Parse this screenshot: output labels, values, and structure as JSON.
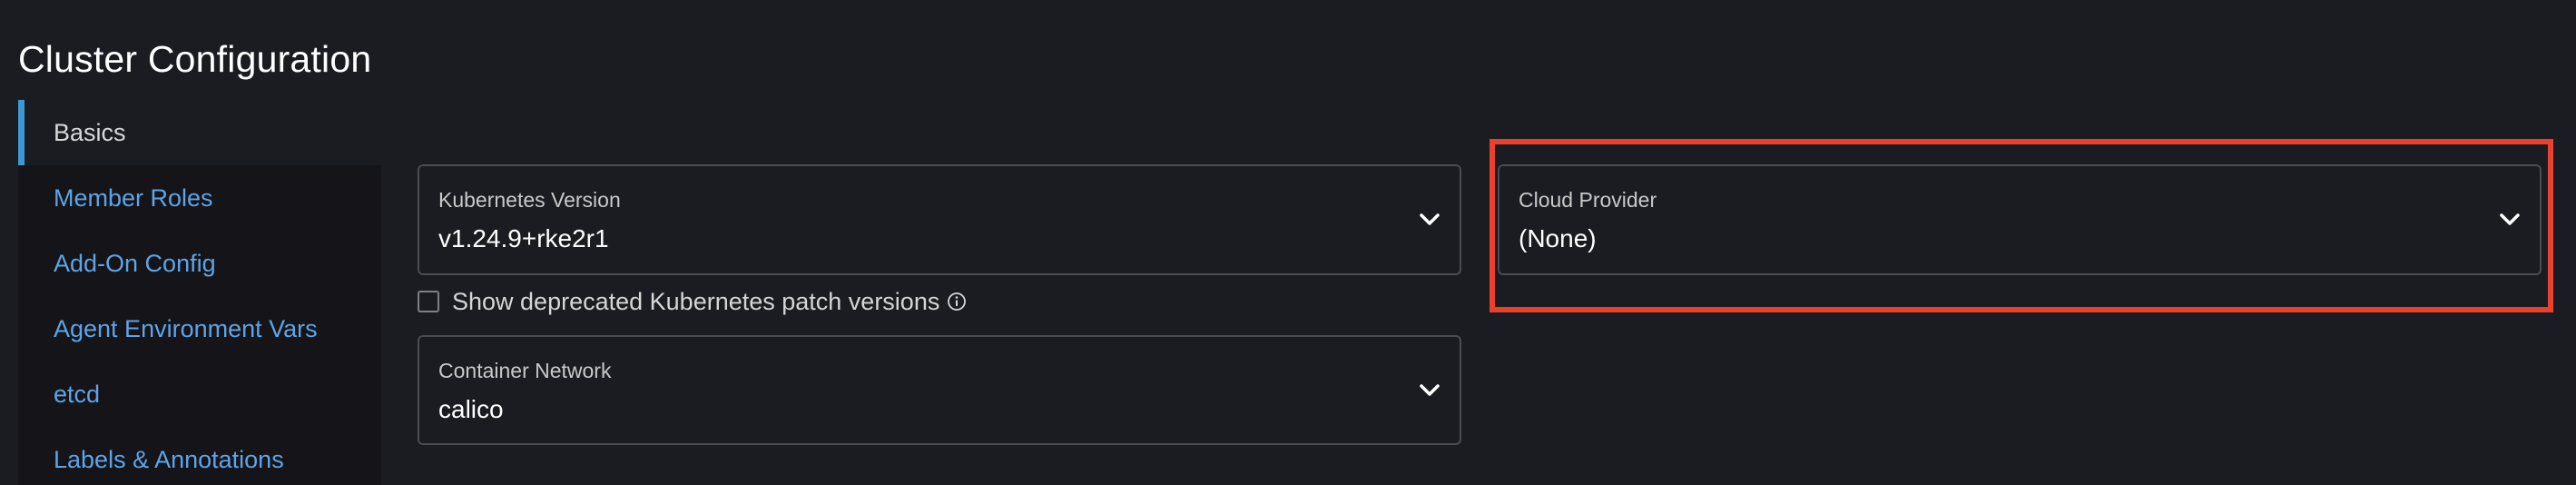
{
  "page": {
    "title": "Cluster Configuration"
  },
  "sidebar": {
    "items": [
      {
        "label": "Basics"
      },
      {
        "label": "Member Roles"
      },
      {
        "label": "Add-On Config"
      },
      {
        "label": "Agent Environment Vars"
      },
      {
        "label": "etcd"
      },
      {
        "label": "Labels & Annotations"
      }
    ],
    "active_index": 0
  },
  "basics": {
    "kubernetes_version": {
      "label": "Kubernetes Version",
      "value": "v1.24.9+rke2r1"
    },
    "show_deprecated": {
      "label": "Show deprecated Kubernetes patch versions",
      "checked": false
    },
    "container_network": {
      "label": "Container Network",
      "value": "calico"
    },
    "cloud_provider": {
      "label": "Cloud Provider",
      "value": "(None)"
    }
  },
  "icons": {
    "dropdown": "chevron-down-icon",
    "info": "info-icon"
  },
  "colors": {
    "background": "#1b1c21",
    "sidebar_background": "#141419",
    "link": "#5ea4e6",
    "active_indicator": "#3d98d3",
    "highlight_border": "#e8412c"
  }
}
